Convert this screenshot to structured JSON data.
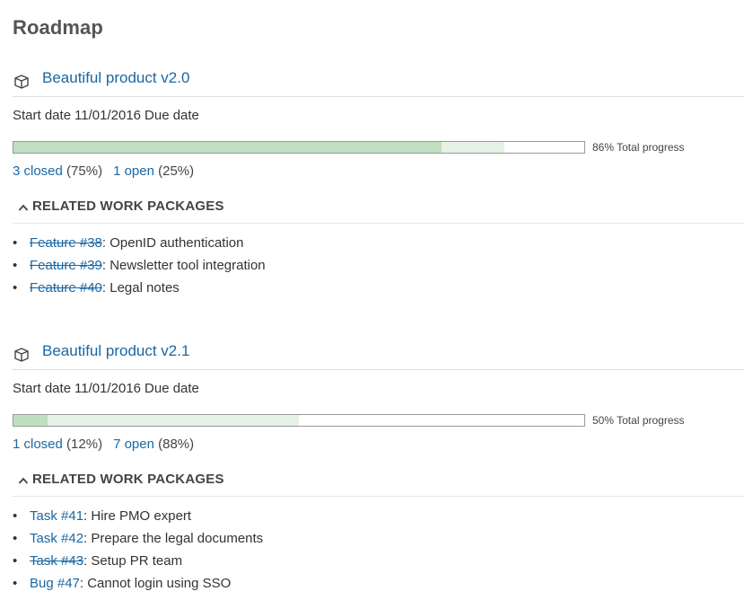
{
  "page": {
    "title": "Roadmap"
  },
  "versions": [
    {
      "title": "Beautiful product v2.0",
      "start_date_label": "Start date",
      "start_date": "11/01/2016",
      "due_date_label": "Due date",
      "progress_percent": 86,
      "closed_percent": 75,
      "progress_text": "86% Total progress",
      "closed_link": "3 closed",
      "closed_pct_text": "(75%)",
      "open_link": "1 open",
      "open_pct_text": "(25%)",
      "related_label": "RELATED WORK PACKAGES",
      "work_packages": [
        {
          "link": "Feature #38",
          "text": ": OpenID authentication",
          "closed": true
        },
        {
          "link": "Feature #39",
          "text": ": Newsletter tool integration",
          "closed": true
        },
        {
          "link": "Feature #40",
          "text": ": Legal notes",
          "closed": true
        }
      ]
    },
    {
      "title": "Beautiful product v2.1",
      "start_date_label": "Start date",
      "start_date": "11/01/2016",
      "due_date_label": "Due date",
      "progress_percent": 50,
      "closed_percent": 6,
      "progress_text": "50% Total progress",
      "closed_link": "1 closed",
      "closed_pct_text": "(12%)",
      "open_link": "7 open",
      "open_pct_text": "(88%)",
      "related_label": "RELATED WORK PACKAGES",
      "work_packages": [
        {
          "link": "Task #41",
          "text": ": Hire PMO expert",
          "closed": false
        },
        {
          "link": "Task #42",
          "text": ": Prepare the legal documents",
          "closed": false
        },
        {
          "link": "Task #43",
          "text": ": Setup PR team",
          "closed": true
        },
        {
          "link": "Bug #47",
          "text": ": Cannot login using SSO",
          "closed": false
        }
      ]
    }
  ],
  "colors": {
    "link": "#1a67a3",
    "progress_done": "#bfdfc0",
    "progress_open": "#e5f2e5"
  },
  "icons": {
    "version": "package-box-icon",
    "collapse": "chevron-up-icon"
  }
}
